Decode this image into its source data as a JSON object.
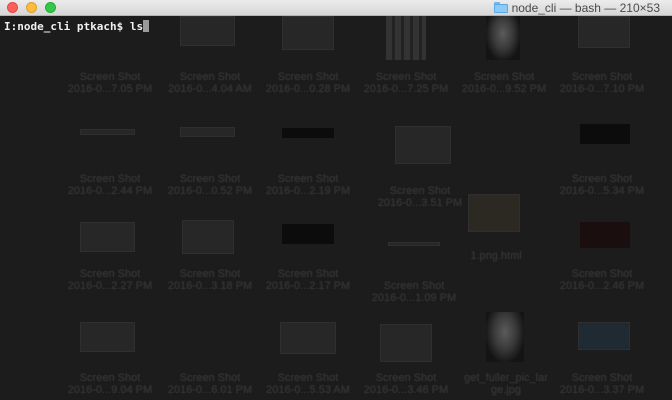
{
  "window": {
    "title": "node_cli — bash — 210×53",
    "title_icon": "folder-icon"
  },
  "terminal": {
    "prompt": "I:node_cli ptkach$ ",
    "command": "ls"
  },
  "desktop_icons": [
    {
      "line1": "Screen Shot",
      "line2": "2016-0...7.05 PM"
    },
    {
      "line1": "Screen Shot",
      "line2": "2016-0...4.04 AM"
    },
    {
      "line1": "Screen Shot",
      "line2": "2016-0...0.28 PM"
    },
    {
      "line1": "Screen Shot",
      "line2": "2016-0...7.25 PM"
    },
    {
      "line1": "Screen Shot",
      "line2": "2016-0...9.52 PM"
    },
    {
      "line1": "Screen Shot",
      "line2": "2016-0...7.10 PM"
    },
    {
      "line1": "Screen Shot",
      "line2": "2016-0...2.44 PM"
    },
    {
      "line1": "Screen Shot",
      "line2": "2016-0...0.52 PM"
    },
    {
      "line1": "Screen Shot",
      "line2": "2016-0...2.19 PM"
    },
    {
      "line1": "Screen Shot",
      "line2": "2016-0...3.51 PM"
    },
    {
      "line1": "Screen Shot",
      "line2": "2016-0...5.34 PM"
    },
    {
      "line1": "Screen Shot",
      "line2": "2016-0...2.27 PM"
    },
    {
      "line1": "Screen Shot",
      "line2": "2016-0...3.18 PM"
    },
    {
      "line1": "Screen Shot",
      "line2": "2016-0...2.17 PM"
    },
    {
      "line1": "Screen Shot",
      "line2": "2016-0...1.09 PM"
    },
    {
      "line1": "Screen Shot",
      "line2": "2016-0...2.46 PM"
    },
    {
      "line1": "1.png.html",
      "line2": ""
    },
    {
      "line1": "Screen Shot",
      "line2": "2016-0...9.04 PM"
    },
    {
      "line1": "Screen Shot",
      "line2": "2016-0...6.01 PM"
    },
    {
      "line1": "Screen Shot",
      "line2": "2016-0...5.53 AM"
    },
    {
      "line1": "Screen Shot",
      "line2": "2016-0...3.46 PM"
    },
    {
      "line1": "get_fuller_pic_lar",
      "line2": "ge.jpg"
    },
    {
      "line1": "Screen Shot",
      "line2": "2016-0...3.37 PM"
    }
  ],
  "colors": {
    "close": "#fc605c",
    "minimize": "#fdbc40",
    "zoom": "#34c84a",
    "terminal_text": "#f0f0f0",
    "background": "#1c1c1c"
  }
}
